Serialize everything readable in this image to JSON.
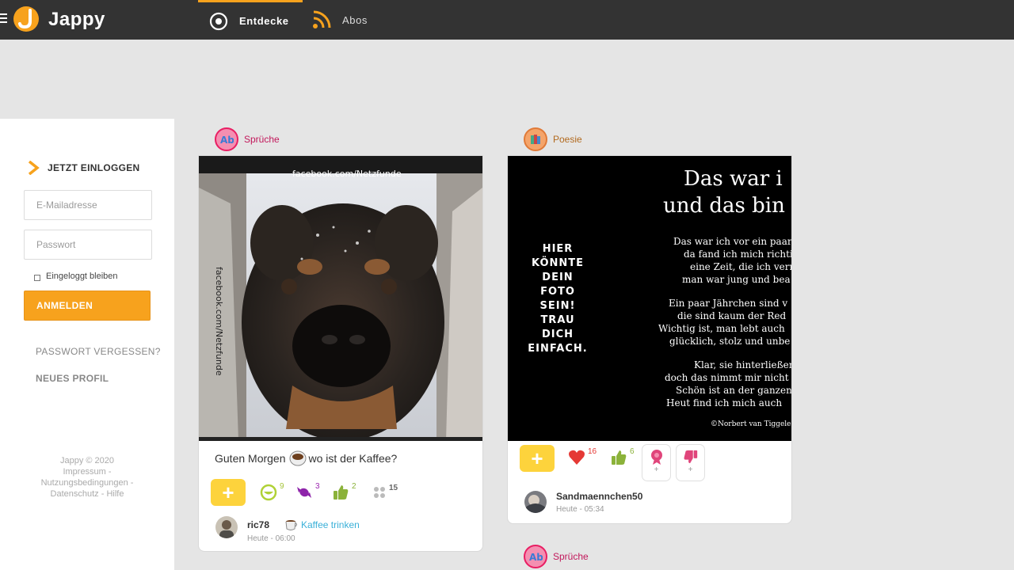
{
  "app": {
    "name": "Jappy"
  },
  "nav": {
    "tabs": [
      {
        "label": "Entdecke",
        "icon": "compass-icon",
        "active": true
      },
      {
        "label": "Abos",
        "icon": "rss-icon",
        "active": false
      }
    ]
  },
  "login": {
    "heading": "JETZT EINLOGGEN",
    "email_placeholder": "E-Mailadresse",
    "password_placeholder": "Passwort",
    "remember_label": "Eingeloggt bleiben",
    "submit_label": "ANMELDEN",
    "forgot_label": "PASSWORT VERGESSEN?",
    "new_profile_label": "NEUES PROFIL"
  },
  "footer": {
    "line1": "Jappy © 2020",
    "line2": "Impressum -",
    "line3": "Nutzungsbedingungen -",
    "line4": "Datenschutz - Hilfe"
  },
  "posts": [
    {
      "category": "Sprüche",
      "image_text": "facebook.com/Netzfunde",
      "text_before": "Guten Morgen",
      "text_after": "wo ist der Kaffee?",
      "plus_label": "+",
      "reactions": [
        {
          "icon": "laugh-icon",
          "count": "9"
        },
        {
          "icon": "candy-icon",
          "count": "3"
        },
        {
          "icon": "thumbs-up-icon",
          "count": "2"
        },
        {
          "icon": "dots-icon",
          "count": "15"
        }
      ],
      "user": "ric78",
      "time": "Heute - 06:00",
      "activity": "Kaffee trinken"
    },
    {
      "category": "Poesie",
      "image_left_text": [
        "HIER",
        "KÖNNTE",
        "DEIN",
        "FOTO",
        "SEIN!",
        "TRAU",
        "DICH",
        "EINFACH."
      ],
      "image_title": [
        "Das war i",
        "und das bin"
      ],
      "image_poem": [
        "Das war ich vor ein paar",
        "da fand ich mich richti",
        "eine Zeit, die ich verm",
        "man war jung und bea",
        "",
        "Ein paar Jährchen sind v",
        "die sind kaum der Red",
        "Wichtig ist, man lebt auch",
        "glücklich, stolz und unbe",
        "",
        "Klar, sie hinterließen S",
        "doch das nimmt mir nicht",
        "Schön ist an der ganzen",
        "Heut find ich mich auch"
      ],
      "image_credit": "©Norbert van Tiggele",
      "plus_label": "+",
      "reactions": [
        {
          "icon": "heart-icon",
          "count": "16"
        },
        {
          "icon": "thumbs-up-icon",
          "count": "6"
        }
      ],
      "extra_plus": [
        "+",
        "+"
      ],
      "user": "Sandmaennchen50",
      "time": "Heute - 05:34"
    },
    {
      "category": "Sprüche"
    }
  ],
  "colors": {
    "accent": "#f7a21d",
    "topbar": "#333333",
    "plus_button": "#fdd33c"
  }
}
